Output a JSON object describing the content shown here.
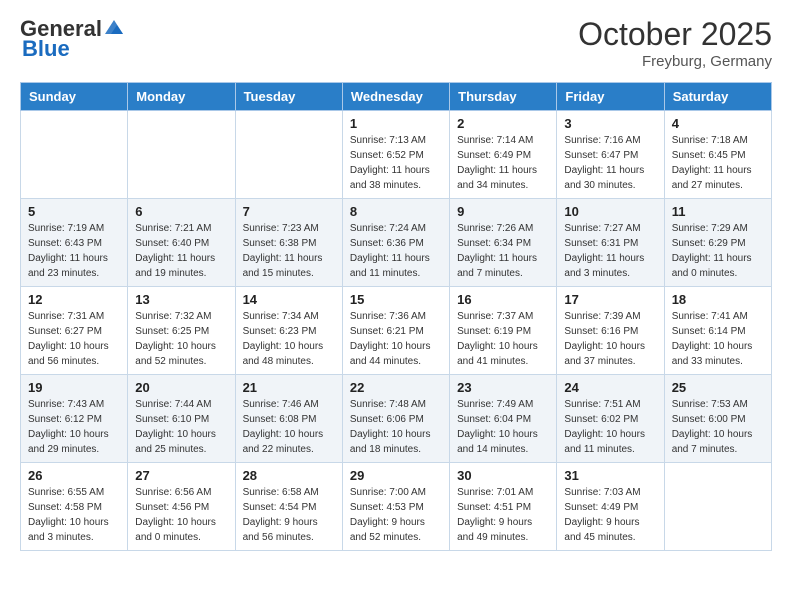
{
  "header": {
    "logo_general": "General",
    "logo_blue": "Blue",
    "month_title": "October 2025",
    "location": "Freyburg, Germany"
  },
  "days_of_week": [
    "Sunday",
    "Monday",
    "Tuesday",
    "Wednesday",
    "Thursday",
    "Friday",
    "Saturday"
  ],
  "weeks": [
    [
      {
        "day": "",
        "sunrise": "",
        "sunset": "",
        "daylight": ""
      },
      {
        "day": "",
        "sunrise": "",
        "sunset": "",
        "daylight": ""
      },
      {
        "day": "",
        "sunrise": "",
        "sunset": "",
        "daylight": ""
      },
      {
        "day": "1",
        "sunrise": "Sunrise: 7:13 AM",
        "sunset": "Sunset: 6:52 PM",
        "daylight": "Daylight: 11 hours and 38 minutes."
      },
      {
        "day": "2",
        "sunrise": "Sunrise: 7:14 AM",
        "sunset": "Sunset: 6:49 PM",
        "daylight": "Daylight: 11 hours and 34 minutes."
      },
      {
        "day": "3",
        "sunrise": "Sunrise: 7:16 AM",
        "sunset": "Sunset: 6:47 PM",
        "daylight": "Daylight: 11 hours and 30 minutes."
      },
      {
        "day": "4",
        "sunrise": "Sunrise: 7:18 AM",
        "sunset": "Sunset: 6:45 PM",
        "daylight": "Daylight: 11 hours and 27 minutes."
      }
    ],
    [
      {
        "day": "5",
        "sunrise": "Sunrise: 7:19 AM",
        "sunset": "Sunset: 6:43 PM",
        "daylight": "Daylight: 11 hours and 23 minutes."
      },
      {
        "day": "6",
        "sunrise": "Sunrise: 7:21 AM",
        "sunset": "Sunset: 6:40 PM",
        "daylight": "Daylight: 11 hours and 19 minutes."
      },
      {
        "day": "7",
        "sunrise": "Sunrise: 7:23 AM",
        "sunset": "Sunset: 6:38 PM",
        "daylight": "Daylight: 11 hours and 15 minutes."
      },
      {
        "day": "8",
        "sunrise": "Sunrise: 7:24 AM",
        "sunset": "Sunset: 6:36 PM",
        "daylight": "Daylight: 11 hours and 11 minutes."
      },
      {
        "day": "9",
        "sunrise": "Sunrise: 7:26 AM",
        "sunset": "Sunset: 6:34 PM",
        "daylight": "Daylight: 11 hours and 7 minutes."
      },
      {
        "day": "10",
        "sunrise": "Sunrise: 7:27 AM",
        "sunset": "Sunset: 6:31 PM",
        "daylight": "Daylight: 11 hours and 3 minutes."
      },
      {
        "day": "11",
        "sunrise": "Sunrise: 7:29 AM",
        "sunset": "Sunset: 6:29 PM",
        "daylight": "Daylight: 11 hours and 0 minutes."
      }
    ],
    [
      {
        "day": "12",
        "sunrise": "Sunrise: 7:31 AM",
        "sunset": "Sunset: 6:27 PM",
        "daylight": "Daylight: 10 hours and 56 minutes."
      },
      {
        "day": "13",
        "sunrise": "Sunrise: 7:32 AM",
        "sunset": "Sunset: 6:25 PM",
        "daylight": "Daylight: 10 hours and 52 minutes."
      },
      {
        "day": "14",
        "sunrise": "Sunrise: 7:34 AM",
        "sunset": "Sunset: 6:23 PM",
        "daylight": "Daylight: 10 hours and 48 minutes."
      },
      {
        "day": "15",
        "sunrise": "Sunrise: 7:36 AM",
        "sunset": "Sunset: 6:21 PM",
        "daylight": "Daylight: 10 hours and 44 minutes."
      },
      {
        "day": "16",
        "sunrise": "Sunrise: 7:37 AM",
        "sunset": "Sunset: 6:19 PM",
        "daylight": "Daylight: 10 hours and 41 minutes."
      },
      {
        "day": "17",
        "sunrise": "Sunrise: 7:39 AM",
        "sunset": "Sunset: 6:16 PM",
        "daylight": "Daylight: 10 hours and 37 minutes."
      },
      {
        "day": "18",
        "sunrise": "Sunrise: 7:41 AM",
        "sunset": "Sunset: 6:14 PM",
        "daylight": "Daylight: 10 hours and 33 minutes."
      }
    ],
    [
      {
        "day": "19",
        "sunrise": "Sunrise: 7:43 AM",
        "sunset": "Sunset: 6:12 PM",
        "daylight": "Daylight: 10 hours and 29 minutes."
      },
      {
        "day": "20",
        "sunrise": "Sunrise: 7:44 AM",
        "sunset": "Sunset: 6:10 PM",
        "daylight": "Daylight: 10 hours and 25 minutes."
      },
      {
        "day": "21",
        "sunrise": "Sunrise: 7:46 AM",
        "sunset": "Sunset: 6:08 PM",
        "daylight": "Daylight: 10 hours and 22 minutes."
      },
      {
        "day": "22",
        "sunrise": "Sunrise: 7:48 AM",
        "sunset": "Sunset: 6:06 PM",
        "daylight": "Daylight: 10 hours and 18 minutes."
      },
      {
        "day": "23",
        "sunrise": "Sunrise: 7:49 AM",
        "sunset": "Sunset: 6:04 PM",
        "daylight": "Daylight: 10 hours and 14 minutes."
      },
      {
        "day": "24",
        "sunrise": "Sunrise: 7:51 AM",
        "sunset": "Sunset: 6:02 PM",
        "daylight": "Daylight: 10 hours and 11 minutes."
      },
      {
        "day": "25",
        "sunrise": "Sunrise: 7:53 AM",
        "sunset": "Sunset: 6:00 PM",
        "daylight": "Daylight: 10 hours and 7 minutes."
      }
    ],
    [
      {
        "day": "26",
        "sunrise": "Sunrise: 6:55 AM",
        "sunset": "Sunset: 4:58 PM",
        "daylight": "Daylight: 10 hours and 3 minutes."
      },
      {
        "day": "27",
        "sunrise": "Sunrise: 6:56 AM",
        "sunset": "Sunset: 4:56 PM",
        "daylight": "Daylight: 10 hours and 0 minutes."
      },
      {
        "day": "28",
        "sunrise": "Sunrise: 6:58 AM",
        "sunset": "Sunset: 4:54 PM",
        "daylight": "Daylight: 9 hours and 56 minutes."
      },
      {
        "day": "29",
        "sunrise": "Sunrise: 7:00 AM",
        "sunset": "Sunset: 4:53 PM",
        "daylight": "Daylight: 9 hours and 52 minutes."
      },
      {
        "day": "30",
        "sunrise": "Sunrise: 7:01 AM",
        "sunset": "Sunset: 4:51 PM",
        "daylight": "Daylight: 9 hours and 49 minutes."
      },
      {
        "day": "31",
        "sunrise": "Sunrise: 7:03 AM",
        "sunset": "Sunset: 4:49 PM",
        "daylight": "Daylight: 9 hours and 45 minutes."
      },
      {
        "day": "",
        "sunrise": "",
        "sunset": "",
        "daylight": ""
      }
    ]
  ]
}
